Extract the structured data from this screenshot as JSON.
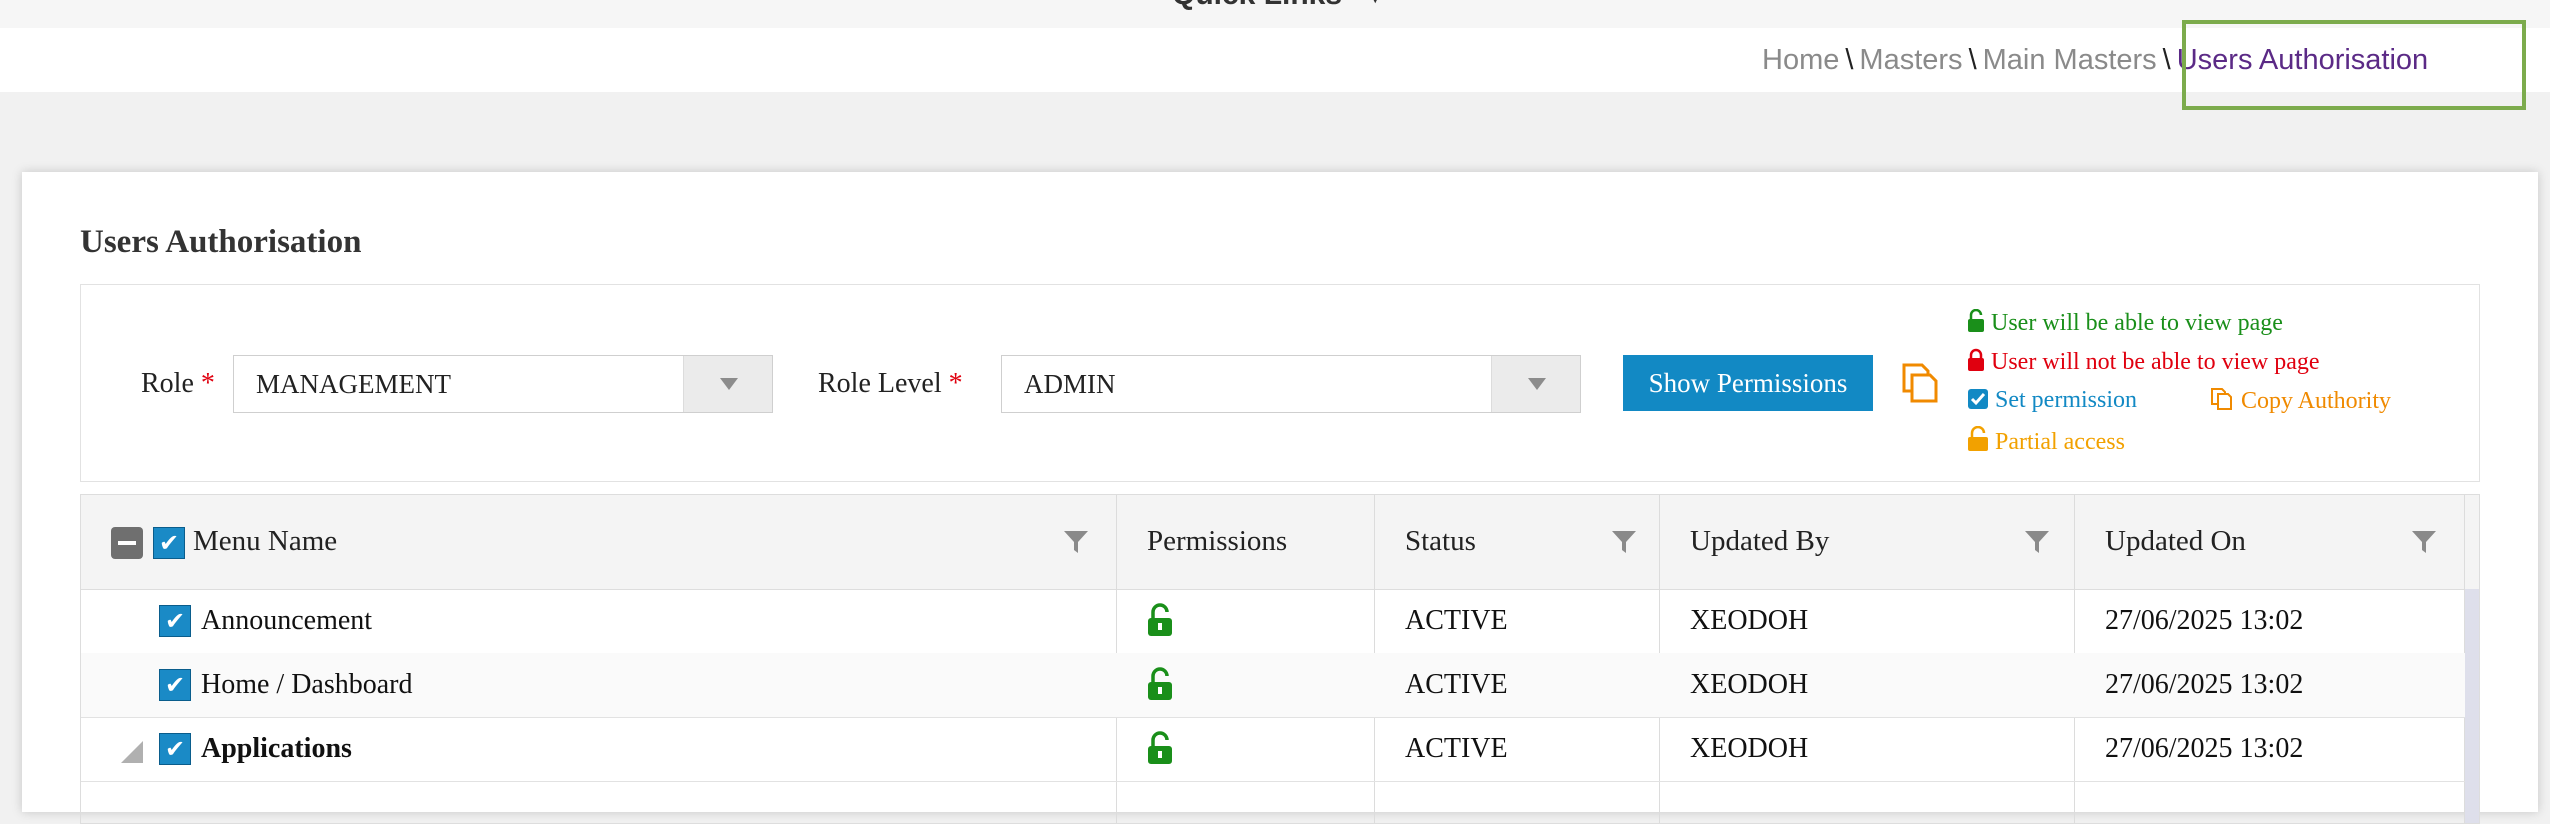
{
  "header": {
    "quick_links": "Quick Links",
    "breadcrumb": [
      "Home",
      "Masters",
      "Main Masters",
      "Users Authorisation"
    ],
    "separator": "\\"
  },
  "panel": {
    "title": "Users Authorisation",
    "role": {
      "label": "Role",
      "required": "*",
      "value": "MANAGEMENT"
    },
    "role_level": {
      "label": "Role Level",
      "required": "*",
      "value": "ADMIN"
    },
    "show_permissions_label": "Show Permissions",
    "legend": {
      "view": "User will be able to view page",
      "no_view": "User will not be able to view page",
      "set_permission": "Set permission",
      "copy_authority": "Copy Authority",
      "partial": "Partial access"
    },
    "colors": {
      "green": "#1a8f1a",
      "red": "#e0000f",
      "blue": "#1289c4",
      "orange": "#f08a00",
      "purple": "#5b2a86",
      "highlight": "#7cab4c"
    }
  },
  "grid": {
    "headers": [
      "Menu Name",
      "Permissions",
      "Status",
      "Updated By",
      "Updated On"
    ],
    "rows": [
      {
        "menu": "Announcement",
        "status": "ACTIVE",
        "updated_by": "XEODOH",
        "updated_on": "27/06/2025 13:02"
      },
      {
        "menu": "Home / Dashboard",
        "status": "ACTIVE",
        "updated_by": "XEODOH",
        "updated_on": "27/06/2025 13:02"
      },
      {
        "menu": "Applications",
        "status": "ACTIVE",
        "updated_by": "XEODOH",
        "updated_on": "27/06/2025 13:02"
      }
    ]
  }
}
